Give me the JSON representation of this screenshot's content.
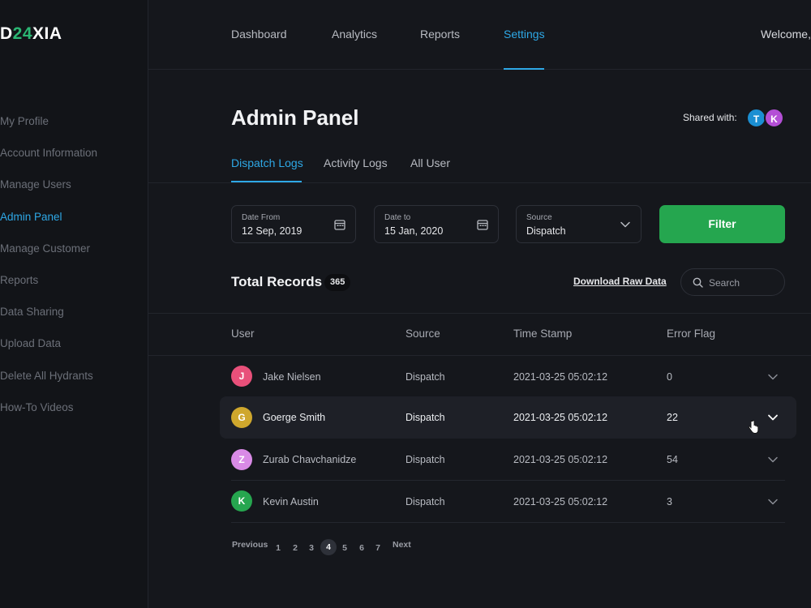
{
  "logo": {
    "part1": "D",
    "part2": "24",
    "part3": "XIA"
  },
  "sidebar": {
    "items": [
      {
        "label": "My Profile",
        "active": false
      },
      {
        "label": "Account Information",
        "active": false
      },
      {
        "label": "Manage Users",
        "active": false
      },
      {
        "label": "Admin Panel",
        "active": true
      },
      {
        "label": "Manage Customer",
        "active": false
      },
      {
        "label": "Reports",
        "active": false
      },
      {
        "label": "Data Sharing",
        "active": false
      },
      {
        "label": "Upload Data",
        "active": false
      },
      {
        "label": "Delete All Hydrants",
        "active": false
      },
      {
        "label": "How-To Videos",
        "active": false
      }
    ]
  },
  "topnav": {
    "items": [
      {
        "label": "Dashboard",
        "active": false
      },
      {
        "label": "Analytics",
        "active": false
      },
      {
        "label": "Reports",
        "active": false
      },
      {
        "label": "Settings",
        "active": true
      }
    ],
    "welcome": "Welcome,"
  },
  "page": {
    "title": "Admin Panel",
    "shared_label": "Shared with:",
    "shared_users": [
      {
        "initial": "T",
        "color": "#1b8fd2"
      },
      {
        "initial": "K",
        "color": "#b44fd6"
      }
    ]
  },
  "tabs": [
    {
      "label": "Dispatch Logs",
      "active": true
    },
    {
      "label": "Activity Logs",
      "active": false
    },
    {
      "label": "All User",
      "active": false
    }
  ],
  "filters": {
    "date_from": {
      "label": "Date From",
      "value": "12 Sep, 2019"
    },
    "date_to": {
      "label": "Date to",
      "value": "15 Jan, 2020"
    },
    "source": {
      "label": "Source",
      "value": "Dispatch"
    },
    "filter_label": "Filter"
  },
  "records": {
    "title": "Total Records",
    "count": "365",
    "download_label": "Download Raw Data",
    "search_placeholder": "Search"
  },
  "table": {
    "columns": [
      "User",
      "Source",
      "Time Stamp",
      "Error Flag"
    ],
    "rows": [
      {
        "initial": "J",
        "avatar_color": "#e8507a",
        "user": "Jake Nielsen",
        "source": "Dispatch",
        "timestamp": "2021-03-25 05:02:12",
        "error_flag": "0",
        "highlighted": false
      },
      {
        "initial": "G",
        "avatar_color": "#cfa72d",
        "user": "Goerge Smith",
        "source": "Dispatch",
        "timestamp": "2021-03-25 05:02:12",
        "error_flag": "22",
        "highlighted": true
      },
      {
        "initial": "Z",
        "avatar_color": "#d98ae6",
        "user": "Zurab Chavchanidze",
        "source": "Dispatch",
        "timestamp": "2021-03-25 05:02:12",
        "error_flag": "54",
        "highlighted": false
      },
      {
        "initial": "K",
        "avatar_color": "#26a64f",
        "user": "Kevin Austin",
        "source": "Dispatch",
        "timestamp": "2021-03-25 05:02:12",
        "error_flag": "3",
        "highlighted": false
      }
    ]
  },
  "pagination": {
    "previous": "Previous",
    "next": "Next",
    "pages": [
      "1",
      "2",
      "3",
      "4",
      "5",
      "6",
      "7"
    ],
    "current": "4"
  },
  "colors": {
    "accent": "#2ea8e6",
    "filter_green": "#25a64f",
    "background": "#15171c"
  }
}
